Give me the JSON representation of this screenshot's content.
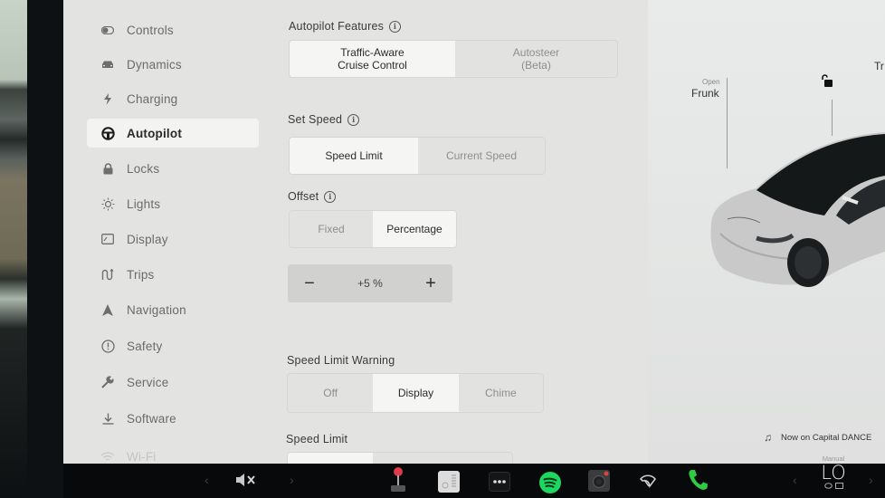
{
  "sidebar": {
    "items": [
      {
        "label": "Controls",
        "icon": "toggle-icon",
        "state": "normal"
      },
      {
        "label": "Dynamics",
        "icon": "car-icon",
        "state": "normal"
      },
      {
        "label": "Charging",
        "icon": "lightning-icon",
        "state": "normal"
      },
      {
        "label": "Autopilot",
        "icon": "steering-wheel-icon",
        "state": "active"
      },
      {
        "label": "Locks",
        "icon": "lock-icon",
        "state": "normal"
      },
      {
        "label": "Lights",
        "icon": "sun-icon",
        "state": "normal"
      },
      {
        "label": "Display",
        "icon": "display-icon",
        "state": "normal"
      },
      {
        "label": "Trips",
        "icon": "trips-icon",
        "state": "normal"
      },
      {
        "label": "Navigation",
        "icon": "navigation-arrow-icon",
        "state": "normal"
      },
      {
        "label": "Safety",
        "icon": "alert-circle-icon",
        "state": "normal"
      },
      {
        "label": "Service",
        "icon": "wrench-icon",
        "state": "normal"
      },
      {
        "label": "Software",
        "icon": "download-icon",
        "state": "normal"
      },
      {
        "label": "Wi-Fi",
        "icon": "wifi-icon",
        "state": "faded"
      }
    ]
  },
  "autopilot_features": {
    "label": "Autopilot Features",
    "options": [
      {
        "line1": "Traffic-Aware",
        "line2": "Cruise Control",
        "selected": true
      },
      {
        "line1": "Autosteer",
        "line2": "(Beta)",
        "selected": false
      }
    ]
  },
  "set_speed": {
    "label": "Set Speed",
    "options": [
      {
        "label": "Speed Limit",
        "selected": true
      },
      {
        "label": "Current Speed",
        "selected": false
      }
    ]
  },
  "offset": {
    "label": "Offset",
    "options": [
      {
        "label": "Fixed",
        "selected": false
      },
      {
        "label": "Percentage",
        "selected": true
      }
    ],
    "stepper": {
      "minus": "−",
      "value": "+5 %",
      "plus": "+"
    }
  },
  "speed_limit_warning": {
    "label": "Speed Limit Warning",
    "options": [
      {
        "label": "Off",
        "selected": false
      },
      {
        "label": "Display",
        "selected": true
      },
      {
        "label": "Chime",
        "selected": false
      }
    ]
  },
  "speed_limit": {
    "label": "Speed Limit"
  },
  "car": {
    "frunk_small": "Open",
    "frunk_big": "Frunk",
    "trunk_big": "Tr",
    "lock_state": "unlocked"
  },
  "media": {
    "now_playing": "Now on Capital DANCE"
  },
  "taskbar": {
    "volume_state": "muted",
    "climate_mode": "Manual",
    "climate_temp": "LO"
  },
  "colors": {
    "spotify_green": "#1ed760",
    "phone_green": "#2ecc40",
    "joystick_red": "#e0394a"
  }
}
